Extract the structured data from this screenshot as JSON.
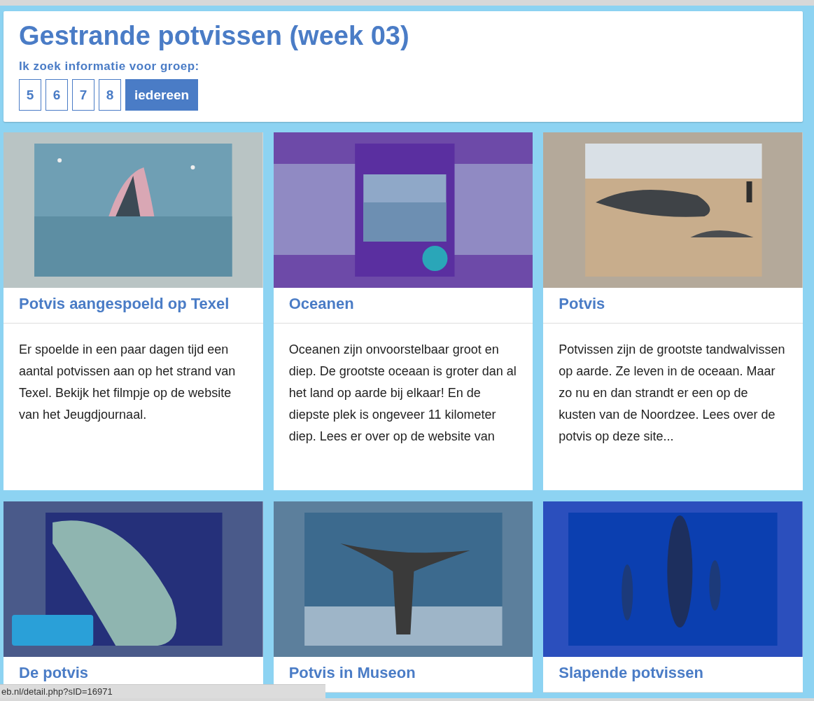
{
  "header": {
    "title": "Gestrande potvissen (week 03)",
    "subtitle": "Ik zoek informatie voor groep:",
    "groups": [
      {
        "label": "5",
        "selected": false
      },
      {
        "label": "6",
        "selected": false
      },
      {
        "label": "7",
        "selected": false
      },
      {
        "label": "8",
        "selected": false
      },
      {
        "label": "iedereen",
        "selected": true
      }
    ]
  },
  "cards": [
    {
      "title": "Potvis aangespoeld op Texel",
      "text": "Er spoelde in een paar dagen tijd een aantal potvissen aan op het strand van Texel. Bekijk het filmpje op de website van het Jeugdjournaal."
    },
    {
      "title": "Oceanen",
      "text": "Oceanen zijn onvoorstelbaar groot en diep. De grootste oceaan is groter dan al het land op aarde bij elkaar! En de diepste plek is ongeveer 11 kilometer diep. Lees er over op de website van"
    },
    {
      "title": "Potvis",
      "text": "Potvissen zijn de grootste tandwalvissen op aarde. Ze leven in de oceaan. Maar zo nu en dan strandt er een op de kusten van de Noordzee. Lees over de potvis op deze site..."
    },
    {
      "title": "De potvis"
    },
    {
      "title": "Potvis in Museon"
    },
    {
      "title": "Slapende potvissen"
    }
  ],
  "status_bar": {
    "url": "eb.nl/detail.php?sID=16971"
  }
}
